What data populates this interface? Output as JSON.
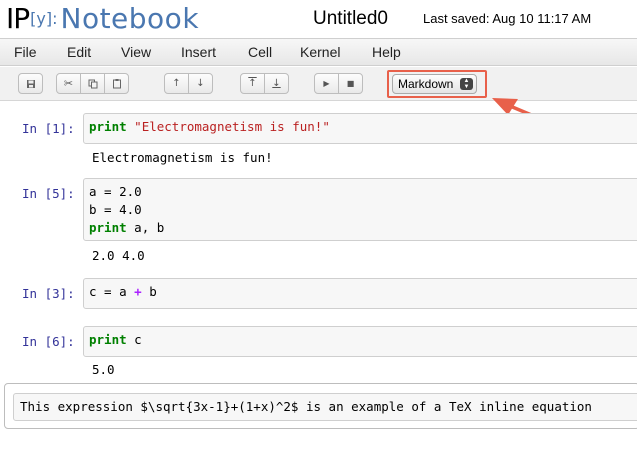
{
  "header": {
    "logo_ip": "IP",
    "logo_y": "[y]:",
    "logo_notebook": "Notebook",
    "notebook_name": "Untitled0",
    "save_status": "Last saved: Aug 10 11:17 AM"
  },
  "menubar": {
    "items": [
      "File",
      "Edit",
      "View",
      "Insert",
      "Cell",
      "Kernel",
      "Help"
    ]
  },
  "toolbar": {
    "cell_type": "Markdown",
    "buttons": [
      "save-icon",
      "cut-icon",
      "copy-icon",
      "paste-icon",
      "move-up-icon",
      "move-down-icon",
      "insert-above-icon",
      "insert-below-icon",
      "run-icon",
      "stop-icon"
    ]
  },
  "annotation": {
    "highlight_color": "#e8604a"
  },
  "cells": [
    {
      "prompt": "In [1]:",
      "lines": [
        [
          {
            "t": "print",
            "c": "kw"
          },
          {
            "t": " "
          },
          {
            "t": "\"Electromagnetism is fun!\"",
            "c": "str"
          }
        ]
      ],
      "output": "Electromagnetism is fun!"
    },
    {
      "prompt": "In [5]:",
      "lines": [
        [
          {
            "t": "a = 2.0"
          }
        ],
        [
          {
            "t": "b = 4.0"
          }
        ],
        [
          {
            "t": "print",
            "c": "kw"
          },
          {
            "t": " a, b"
          }
        ]
      ],
      "output": "2.0 4.0"
    },
    {
      "prompt": "In [3]:",
      "lines": [
        [
          {
            "t": "c = a "
          },
          {
            "t": "+",
            "c": "op"
          },
          {
            "t": " b"
          }
        ]
      ],
      "output": ""
    },
    {
      "prompt": "In [6]:",
      "lines": [
        [
          {
            "t": "print",
            "c": "kw"
          },
          {
            "t": " c"
          }
        ]
      ],
      "output": "5.0"
    }
  ],
  "markdown_cell": {
    "text": "This expression $\\sqrt{3x-1}+(1+x)^2$ is an example of a TeX inline equation"
  },
  "colors": {
    "prompt": "#333399",
    "keyword": "#008000",
    "string": "#ba2121",
    "operator": "#aa22ff",
    "logo_blue": "#4a77b0"
  }
}
